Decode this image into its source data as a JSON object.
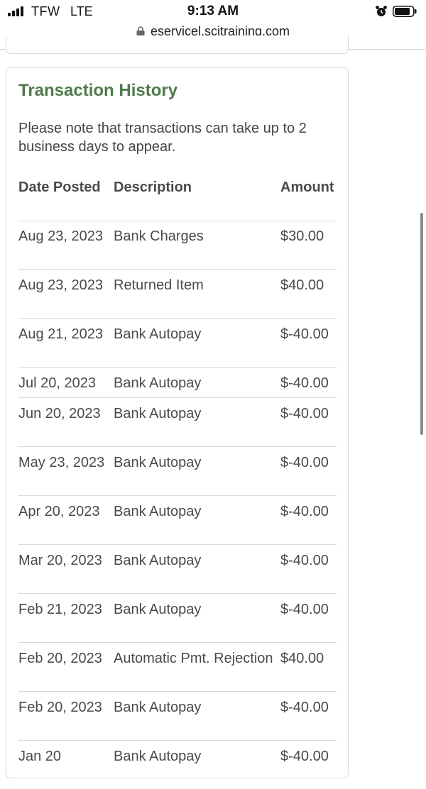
{
  "status_bar": {
    "carrier": "TFW",
    "network": "LTE",
    "time": "9:13 AM"
  },
  "browser": {
    "url": "eservicel.scitraining.com"
  },
  "transaction_history": {
    "title": "Transaction History",
    "note": "Please note that transactions can take up to 2 business days to appear.",
    "columns": {
      "date": "Date Posted",
      "description": "Description",
      "amount": "Amount"
    },
    "rows": [
      {
        "date": "Aug 23, 2023",
        "description": "Bank Charges",
        "amount": "$30.00"
      },
      {
        "date": "Aug 23, 2023",
        "description": "Returned Item",
        "amount": "$40.00"
      },
      {
        "date": "Aug 21, 2023",
        "description": "Bank Autopay",
        "amount": "$-40.00"
      },
      {
        "date": "Jul 20, 2023",
        "description": "Bank Autopay",
        "amount": "$-40.00"
      },
      {
        "date": "Jun 20, 2023",
        "description": "Bank Autopay",
        "amount": "$-40.00"
      },
      {
        "date": "May 23, 2023",
        "description": "Bank Autopay",
        "amount": "$-40.00"
      },
      {
        "date": "Apr 20, 2023",
        "description": "Bank Autopay",
        "amount": "$-40.00"
      },
      {
        "date": "Mar 20, 2023",
        "description": "Bank Autopay",
        "amount": "$-40.00"
      },
      {
        "date": "Feb 21, 2023",
        "description": "Bank Autopay",
        "amount": "$-40.00"
      },
      {
        "date": "Feb 20, 2023",
        "description": "Automatic Pmt. Rejection",
        "amount": "$40.00"
      },
      {
        "date": "Feb 20, 2023",
        "description": "Bank Autopay",
        "amount": "$-40.00"
      },
      {
        "date": "Jan 20",
        "description": "Bank Autopay",
        "amount": "$-40.00"
      }
    ]
  }
}
